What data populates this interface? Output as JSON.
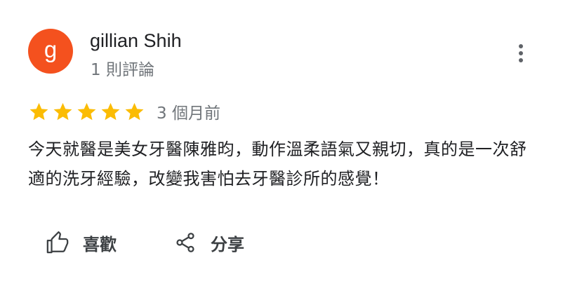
{
  "review": {
    "avatar_letter": "g",
    "avatar_color": "#f4511e",
    "reviewer_name": "gillian Shih",
    "review_count": "1 則評論",
    "rating": 5,
    "rating_max": 5,
    "star_color": "#fbbc04",
    "date": "3 個月前",
    "text": "今天就醫是美女牙醫陳雅昀，動作溫柔語氣又親切，真的是一次舒適的洗牙經驗，改變我害怕去牙醫診所的感覺！"
  },
  "actions": {
    "like_label": "喜歡",
    "like_icon": "thumb-up-icon",
    "share_label": "分享",
    "share_icon": "share-icon"
  },
  "menu": {
    "icon": "more-vert-icon"
  }
}
